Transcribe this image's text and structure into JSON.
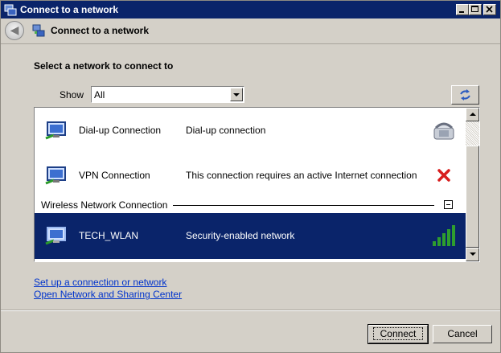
{
  "window": {
    "title": "Connect to a network"
  },
  "header": {
    "title": "Connect to a network",
    "back_glyph": "◀"
  },
  "main": {
    "heading": "Select a network to connect to",
    "show_label": "Show",
    "show_value": "All"
  },
  "networks": [
    {
      "name": "Dial-up Connection",
      "description": "Dial-up connection",
      "status_icon": "telephone-icon"
    },
    {
      "name": "VPN Connection",
      "description": "This connection requires an active Internet connection",
      "status_icon": "red-x-icon"
    }
  ],
  "group": {
    "label": "Wireless Network Connection"
  },
  "wireless": [
    {
      "name": "TECH_WLAN",
      "description": "Security-enabled network",
      "status_icon": "signal-strength-icon",
      "signal_bars": 5,
      "signal_bars_max": 5
    }
  ],
  "links": {
    "setup": "Set up a connection or network",
    "sharing_center": "Open Network and Sharing Center"
  },
  "footer": {
    "connect_label": "Connect",
    "cancel_label": "Cancel"
  },
  "colors": {
    "selection": "#0a246a",
    "link": "#0033cc",
    "signal": "#2e9e2e",
    "error": "#d81e1e"
  }
}
